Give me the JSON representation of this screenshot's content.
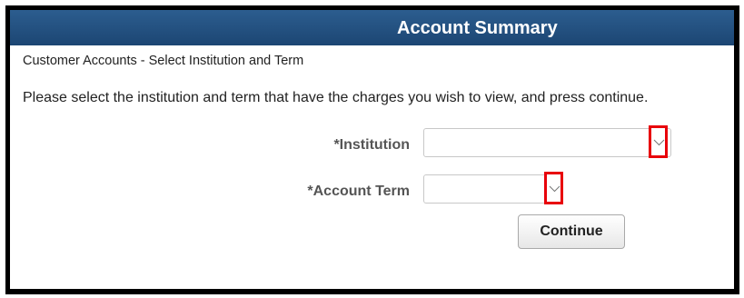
{
  "header": {
    "title": "Account Summary"
  },
  "page": {
    "subtitle": "Customer Accounts - Select Institution and Term",
    "instructions": "Please select the institution and term that have the charges you wish to view, and press continue."
  },
  "form": {
    "institution": {
      "label": "*Institution",
      "value": ""
    },
    "account_term": {
      "label": "*Account Term",
      "value": ""
    },
    "continue_label": "Continue"
  },
  "colors": {
    "header_bg": "#1f4a78",
    "highlight": "#e8000a"
  },
  "icons": {
    "dropdown": "chevron-down-icon"
  }
}
